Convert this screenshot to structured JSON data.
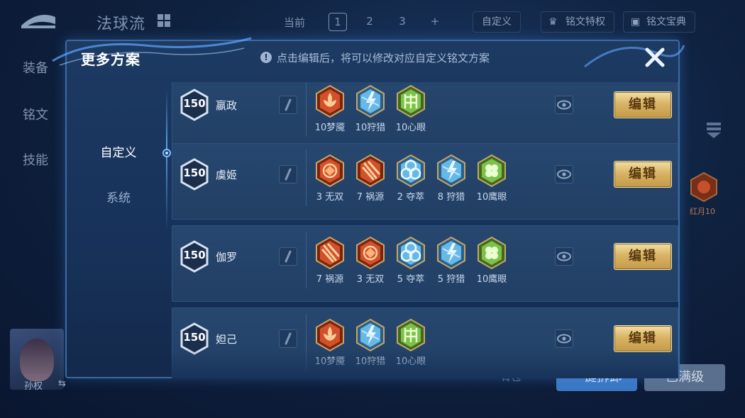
{
  "background": {
    "title": "法球流",
    "current_label": "当前",
    "pages": [
      "1",
      "2",
      "3",
      "+"
    ],
    "selected_page": "1",
    "custom_label": "自定义",
    "privilege_label": "铭文特权",
    "codex_label": "铭文宝典",
    "side_menu": [
      "装备",
      "铭文",
      "技能"
    ],
    "right_rune_label": "红月10",
    "hero_name": "孙权",
    "swap_icon": "swap-icon",
    "bottom_left_text": "背包",
    "bottom_mid_button": "一键拆卸",
    "bottom_right_button": "已满级"
  },
  "modal": {
    "title": "更多方案",
    "notice": "点击编辑后，将可以修改对应自定义铭文方案",
    "info_icon": "!",
    "tabs": [
      {
        "label": "自定义",
        "active": true
      },
      {
        "label": "系统",
        "active": false
      }
    ],
    "plans": [
      {
        "level": "150",
        "name": "嬴政",
        "edit_label": "编辑",
        "runes": [
          {
            "kind": "red-flower",
            "label": "10梦魇"
          },
          {
            "kind": "blue-bolt",
            "label": "10狩猎"
          },
          {
            "kind": "green-gate",
            "label": "10心眼"
          }
        ]
      },
      {
        "level": "150",
        "name": "虞姬",
        "edit_label": "编辑",
        "runes": [
          {
            "kind": "red-gem",
            "label": "3 无双"
          },
          {
            "kind": "red-claw",
            "label": "7 祸源"
          },
          {
            "kind": "blue-knot",
            "label": "2 夺萃"
          },
          {
            "kind": "blue-bolt",
            "label": "8 狩猎"
          },
          {
            "kind": "green-clover",
            "label": "10鹰眼"
          }
        ]
      },
      {
        "level": "150",
        "name": "伽罗",
        "edit_label": "编辑",
        "runes": [
          {
            "kind": "red-claw",
            "label": "7 祸源"
          },
          {
            "kind": "red-gem",
            "label": "3 无双"
          },
          {
            "kind": "blue-knot",
            "label": "5 夺萃"
          },
          {
            "kind": "blue-bolt",
            "label": "5 狩猎"
          },
          {
            "kind": "green-clover",
            "label": "10鹰眼"
          }
        ]
      },
      {
        "level": "150",
        "name": "妲己",
        "edit_label": "编辑",
        "runes": [
          {
            "kind": "red-flower",
            "label": "10梦魇"
          },
          {
            "kind": "blue-bolt",
            "label": "10狩猎"
          },
          {
            "kind": "green-gate",
            "label": "10心眼"
          }
        ]
      }
    ]
  },
  "colors": {
    "modal_border": "#3a6aa3",
    "row_bg": "#26476f",
    "edit_button_gold": "#d9b466",
    "rune_red": "#d2512a",
    "rune_blue": "#67b8e6",
    "rune_green": "#7ec04c"
  }
}
